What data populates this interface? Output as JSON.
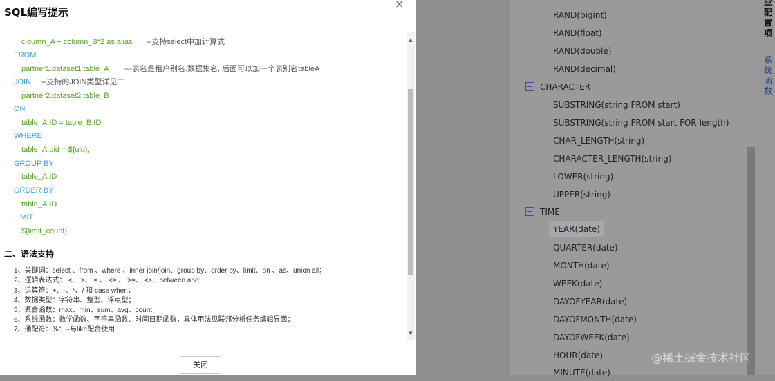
{
  "modal": {
    "title": "SQL编写提示",
    "close_icon": "×",
    "close_button": "关闭",
    "code_lines": [
      {
        "cls": "val",
        "text": "cloumn_A + column_B*2 as alias"
      },
      {
        "cls": "kw",
        "text": "FROM"
      },
      {
        "cls": "val",
        "text": "partner1.dataset1 table_A"
      },
      {
        "cls": "kw",
        "text": "JOIN"
      },
      {
        "cls": "val",
        "text": "partner2.dataset2 table_B"
      },
      {
        "cls": "kw",
        "text": "ON"
      },
      {
        "cls": "val",
        "text": "table_A.ID = table_B.ID"
      },
      {
        "cls": "kw",
        "text": "WHERE"
      },
      {
        "cls": "val",
        "text": "table_A.uid = ${uid};"
      },
      {
        "cls": "kw",
        "text": "GROUP BY"
      },
      {
        "cls": "val",
        "text": "table_A.ID"
      },
      {
        "cls": "kw",
        "text": "ORDER BY"
      },
      {
        "cls": "val",
        "text": "table_A.ID"
      },
      {
        "cls": "kw",
        "text": "LIMIT"
      },
      {
        "cls": "val",
        "text": "${limit_count}"
      }
    ],
    "comments": {
      "select_calc": "--支持select中加计算式",
      "table_alias": "---表名是租户别名.数据集名, 后面可以加一个表别名tableA",
      "join_types": "--支持的JOIN类型详见二"
    },
    "section2_title": "二、语法支持",
    "rules": [
      "1、关键词：select 、from 、where 、inner join/join、group by、order by、limit、on 、as、union all；",
      "2、逻辑表达式： <、 >、 = 、 <= 、 >=、 <>、between and;",
      "3、运算符：+、-、*、/ 和 case when；",
      "4、数据类型：字符串、整型、浮点型；",
      "5、聚合函数：max、min、sum、avg、count;",
      "6、系统函数：数学函数、字符串函数、时间日期函数，具体用法见联邦分析任务编辑界面；",
      "7、通配符：%：--与like配合使用"
    ]
  },
  "tree": {
    "items_top": [
      "RAND(bigint)",
      "RAND(float)",
      "RAND(double)",
      "RAND(decimal)"
    ],
    "cat_character": "CHARACTER",
    "character_items": [
      "SUBSTRING(string FROM start)",
      "SUBSTRING(string FROM start FOR length)",
      "CHAR_LENGTH(string)",
      "CHARACTER_LENGTH(string)",
      "LOWER(string)",
      "UPPER(string)"
    ],
    "cat_time": "TIME",
    "time_items": [
      "YEAR(date)",
      "QUARTER(date)",
      "MONTH(date)",
      "WEEK(date)",
      "DAYOFYEAR(date)",
      "DAYOFMONTH(date)",
      "DAYOFWEEK(date)",
      "HOUR(date)",
      "MINUTE(date)"
    ]
  },
  "side_tabs": {
    "config": "业配置项",
    "functions": "系统函数"
  },
  "watermark": "@稀土掘金技术社区"
}
